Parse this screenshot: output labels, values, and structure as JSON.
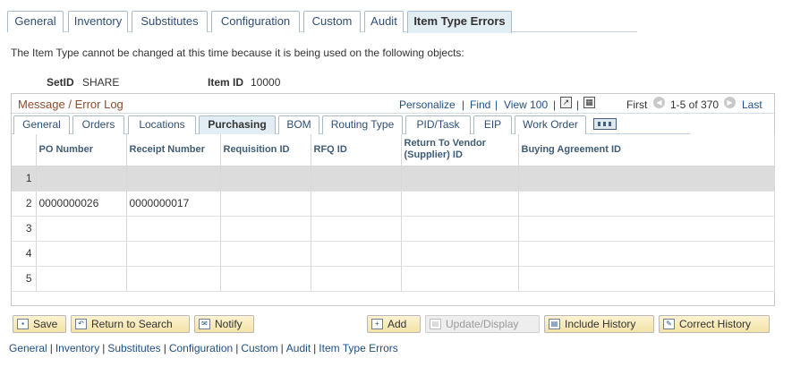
{
  "top_tabs": [
    {
      "label": "General"
    },
    {
      "label": "Inventory"
    },
    {
      "label": "Substitutes"
    },
    {
      "label": "Configuration"
    },
    {
      "label": "Custom"
    },
    {
      "label": "Audit"
    },
    {
      "label": "Item Type Errors",
      "active": true
    }
  ],
  "notice": "The Item Type cannot be changed at this time because it is being used on the following objects:",
  "setid": {
    "label": "SetID",
    "value": "SHARE"
  },
  "itemid": {
    "label": "Item ID",
    "value": "10000"
  },
  "grid": {
    "title": "Message / Error Log",
    "personalize": "Personalize",
    "find": "Find",
    "view": "View 100",
    "first": "First",
    "range": "1-5 of 370",
    "last": "Last"
  },
  "inner_tabs": [
    {
      "label": "General"
    },
    {
      "label": "Orders"
    },
    {
      "label": "Locations"
    },
    {
      "label": "Purchasing",
      "active": true
    },
    {
      "label": "BOM"
    },
    {
      "label": "Routing Type"
    },
    {
      "label": "PID/Task"
    },
    {
      "label": "EIP"
    },
    {
      "label": "Work Order"
    }
  ],
  "columns": [
    "PO Number",
    "Receipt Number",
    "Requisition ID",
    "RFQ ID",
    "Return To Vendor (Supplier) ID",
    "Buying Agreement ID"
  ],
  "rows": [
    {
      "num": "1",
      "po": "",
      "receipt": "",
      "req": "",
      "rfq": "",
      "rtv": "",
      "ba": ""
    },
    {
      "num": "2",
      "po": "0000000026",
      "receipt": "0000000017",
      "req": "",
      "rfq": "",
      "rtv": "",
      "ba": ""
    },
    {
      "num": "3",
      "po": "",
      "receipt": "",
      "req": "",
      "rfq": "",
      "rtv": "",
      "ba": ""
    },
    {
      "num": "4",
      "po": "",
      "receipt": "",
      "req": "",
      "rfq": "",
      "rtv": "",
      "ba": ""
    },
    {
      "num": "5",
      "po": "",
      "receipt": "",
      "req": "",
      "rfq": "",
      "rtv": "",
      "ba": ""
    }
  ],
  "toolbar": {
    "save": "Save",
    "return": "Return to Search",
    "notify": "Notify",
    "add": "Add",
    "update": "Update/Display",
    "include": "Include History",
    "correct": "Correct History"
  },
  "footer_links": [
    "General",
    "Inventory",
    "Substitutes",
    "Configuration",
    "Custom",
    "Audit",
    "Item Type Errors"
  ],
  "colors": {
    "link": "#1f4f82",
    "grid_title": "#8c4b2c",
    "highlight_row": "#dcdcdc",
    "button": "#f3e3a8"
  }
}
